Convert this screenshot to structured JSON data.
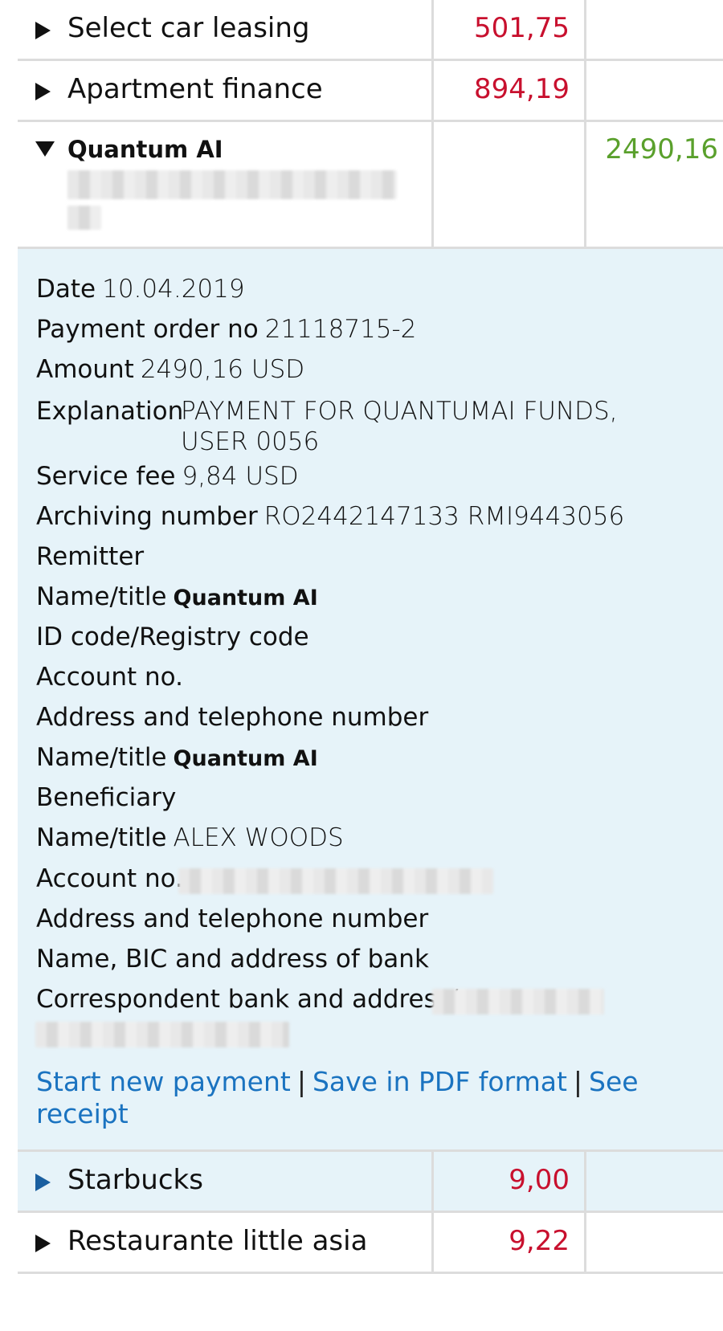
{
  "transactions": [
    {
      "name": "Select car leasing",
      "debit": "501,75",
      "credit": ""
    },
    {
      "name": "Apartment finance",
      "debit": "894,19",
      "credit": ""
    },
    {
      "name": "Quantum AI",
      "debit": "",
      "credit": "2490,16"
    },
    {
      "name": "Starbucks",
      "debit": "9,00",
      "credit": ""
    },
    {
      "name": "Restaurante little asia",
      "debit": "9,22",
      "credit": ""
    }
  ],
  "details": {
    "date_label": "Date",
    "date_value": "10.04.2019",
    "order_label": "Payment order no",
    "order_value": "21118715-2",
    "amount_label": "Amount",
    "amount_value": "2490,16 USD",
    "explanation_label": "Explanation",
    "explanation_value": "PAYMENT FOR QUANTUMAI FUNDS, USER 0056",
    "fee_label": "Service fee",
    "fee_value": "9,84 USD",
    "archive_label": "Archiving number",
    "archive_value": "RO2442147133 RMI9443056",
    "remitter_heading": "Remitter",
    "remitter_name_label": "Name/title",
    "remitter_name_value": "Quantum AI",
    "id_label": "ID code/Registry code",
    "remitter_account_label": "Account no.",
    "remitter_address_label": "Address and telephone number",
    "remitter_name2_label": "Name/title",
    "remitter_name2_value": "Quantum AI",
    "beneficiary_heading": "Beneficiary",
    "beneficiary_name_label": "Name/title",
    "beneficiary_name_value": "ALEX WOODS",
    "beneficiary_account_label": "Account no.",
    "beneficiary_address_label": "Address and telephone number",
    "bank_label": "Name, BIC and address of bank",
    "correspondent_label": "Correspondent bank and address/"
  },
  "actions": {
    "new_payment": "Start new payment",
    "save_pdf": "Save in PDF format",
    "see_receipt": "See receipt",
    "separator": "|"
  },
  "colors": {
    "debit": "#c8102e",
    "credit": "#5aa02c",
    "link": "#1a73c0",
    "detail_bg": "#e6f3f9"
  }
}
